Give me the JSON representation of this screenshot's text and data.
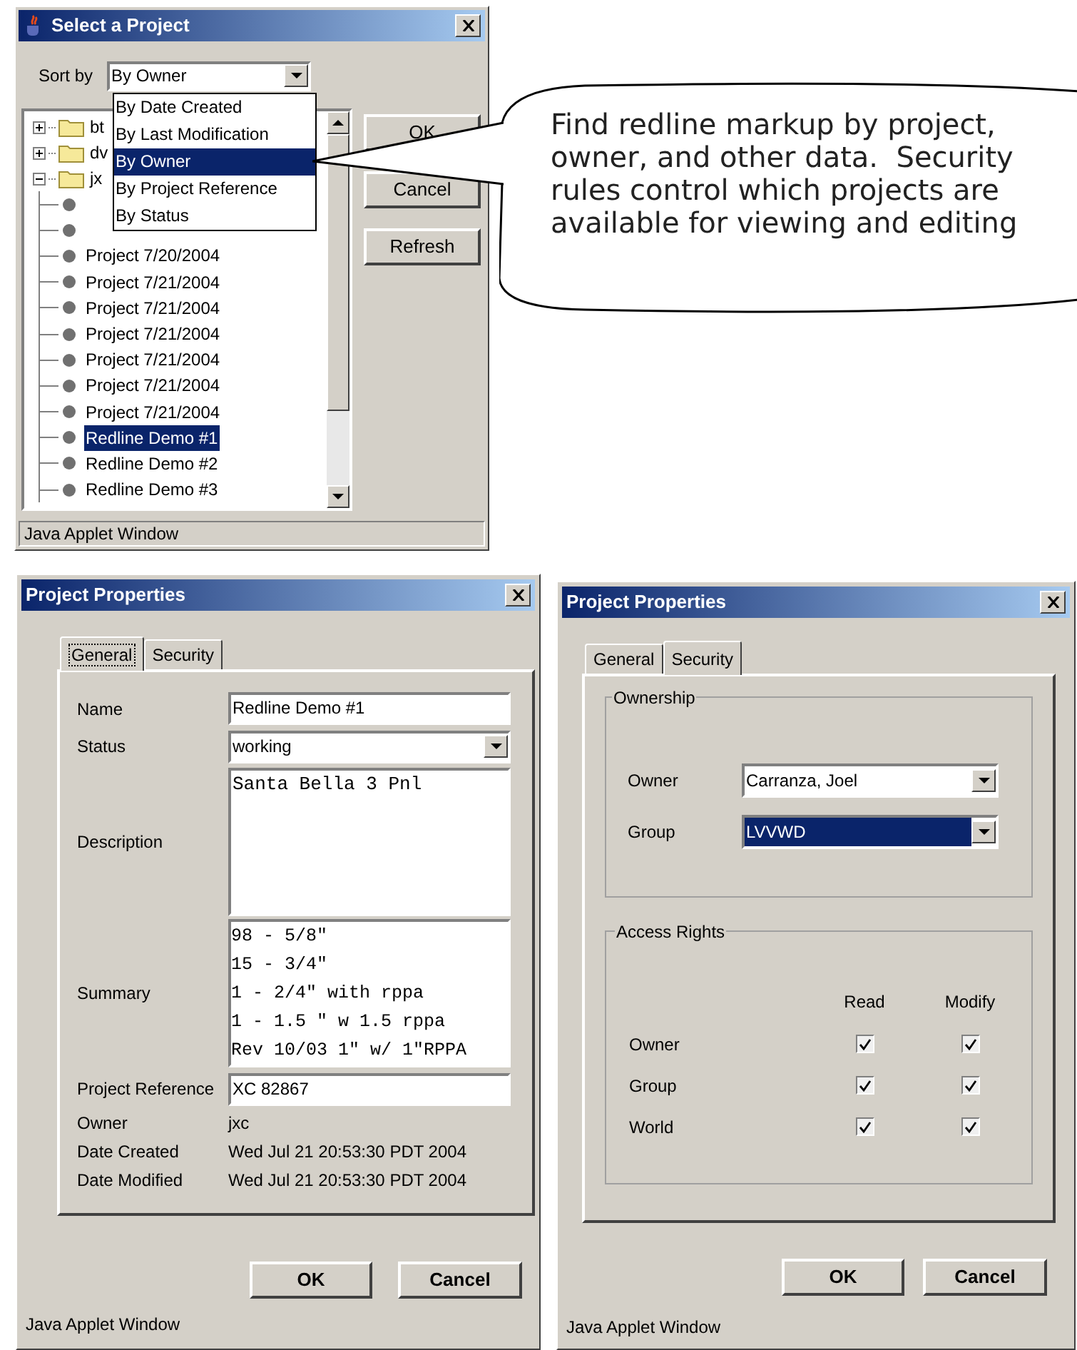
{
  "select_window": {
    "title": "Select a Project",
    "sort_label": "Sort by",
    "sort_value": "By Owner",
    "sort_options": [
      {
        "label": "By Date Created",
        "selected": false
      },
      {
        "label": "By Last Modification",
        "selected": false
      },
      {
        "label": "By Owner",
        "selected": true
      },
      {
        "label": "By Project Reference",
        "selected": false
      },
      {
        "label": "By Status",
        "selected": false
      }
    ],
    "tree": [
      {
        "label": "bt",
        "expanded": false
      },
      {
        "label": "dv",
        "expanded": false
      },
      {
        "label": "jx",
        "expanded": true,
        "children": [
          {
            "kind": "covered"
          },
          {
            "kind": "covered"
          },
          {
            "kind": "item",
            "label": "Project 7/20/2004",
            "selected": false
          },
          {
            "kind": "item",
            "label": "Project 7/21/2004",
            "selected": false
          },
          {
            "kind": "item",
            "label": "Project 7/21/2004",
            "selected": false
          },
          {
            "kind": "item",
            "label": "Project 7/21/2004",
            "selected": false
          },
          {
            "kind": "item",
            "label": "Project 7/21/2004",
            "selected": false
          },
          {
            "kind": "item",
            "label": "Project 7/21/2004",
            "selected": false
          },
          {
            "kind": "item",
            "label": "Project 7/21/2004",
            "selected": false
          },
          {
            "kind": "item",
            "label": "Redline Demo #1",
            "selected": true
          },
          {
            "kind": "item",
            "label": "Redline Demo #2",
            "selected": false
          },
          {
            "kind": "item",
            "label": "Redline Demo #3",
            "selected": false
          }
        ]
      }
    ],
    "buttons": [
      "OK",
      "Cancel",
      "Refresh"
    ],
    "status_bar": "Java Applet Window"
  },
  "callout": {
    "text": "Find redline markup by project, owner, and other data.  Security rules control which projects are available for viewing and editing"
  },
  "general_window": {
    "title": "Project Properties",
    "tabs": [
      {
        "label": "General",
        "selected": true
      },
      {
        "label": "Security",
        "selected": false
      }
    ],
    "name_label": "Name",
    "name_value": "Redline Demo #1",
    "status_label": "Status",
    "status_value": "working",
    "description_label": "Description",
    "description_lines": [
      "Santa Bella 3 Pnl"
    ],
    "summary_label": "Summary",
    "summary_lines": [
      "98 - 5/8\"",
      "15 - 3/4\"",
      "1 - 2/4\" with rppa",
      "1 - 1.5 \" w 1.5 rppa",
      "Rev 10/03 1\" w/ 1\"RPPA"
    ],
    "reference_label": "Project Reference",
    "reference_value": "XC 82867",
    "info": [
      {
        "label": "Owner",
        "value": "jxc"
      },
      {
        "label": "Date Created",
        "value": "Wed Jul 21 20:53:30 PDT 2004"
      },
      {
        "label": "Date Modified",
        "value": "Wed Jul 21 20:53:30 PDT 2004"
      }
    ],
    "buttons": [
      "OK",
      "Cancel"
    ],
    "status_bar": "Java Applet Window"
  },
  "security_window": {
    "title": "Project Properties",
    "tabs": [
      {
        "label": "General",
        "selected": false
      },
      {
        "label": "Security",
        "selected": true
      }
    ],
    "ownership_title": "Ownership",
    "owner_label": "Owner",
    "owner_value": "Carranza, Joel",
    "owner_focused": false,
    "group_label": "Group",
    "group_value": "LVVWD",
    "group_focused": true,
    "access_title": "Access Rights",
    "columns": [
      "Read",
      "Modify"
    ],
    "rights": [
      {
        "label": "Owner",
        "read": true,
        "modify": true
      },
      {
        "label": "Group",
        "read": true,
        "modify": true
      },
      {
        "label": "World",
        "read": true,
        "modify": true
      }
    ],
    "buttons": [
      "OK",
      "Cancel"
    ],
    "status_bar": "Java Applet Window"
  }
}
